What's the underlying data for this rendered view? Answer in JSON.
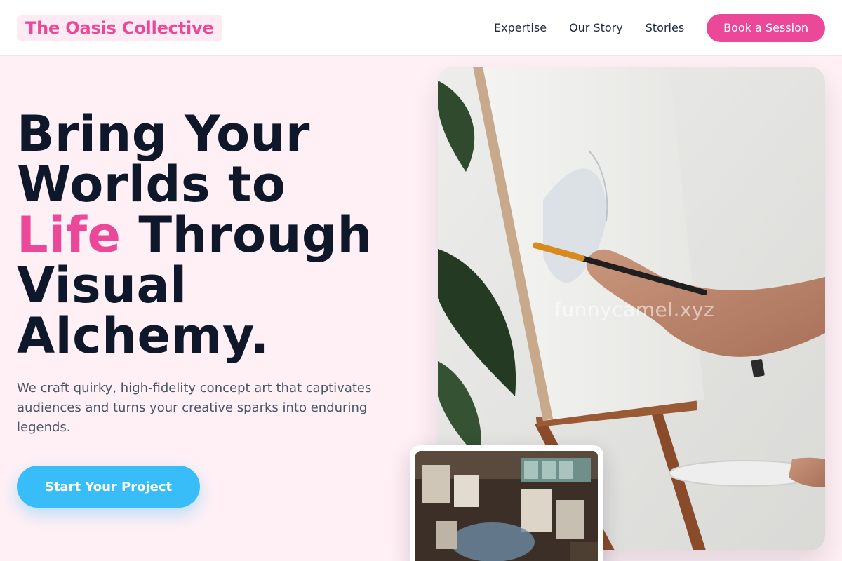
{
  "header": {
    "brand": "The Oasis Collective",
    "nav": [
      "Expertise",
      "Our Story",
      "Stories"
    ],
    "cta": "Book a Session"
  },
  "hero": {
    "title_line1": "Bring Your",
    "title_line2": "Worlds to",
    "title_accent": "Life",
    "title_line3_rest": " Through",
    "title_line4": "Visual",
    "title_line5": "Alchemy.",
    "subtitle": "We craft quirky, high-fidelity concept art that captivates audiences and turns your creative sparks into enduring legends.",
    "cta": "Start Your Project",
    "image_watermark": "funnycamel.xyz"
  },
  "colors": {
    "brand": "#ec4899",
    "accent_blue": "#38bdf8",
    "page_background": "#fff0f5",
    "heading": "#0f172a"
  },
  "images": {
    "hero": "painter-at-easel-photo",
    "thumbnail": "art-studio-overhead-photo"
  }
}
